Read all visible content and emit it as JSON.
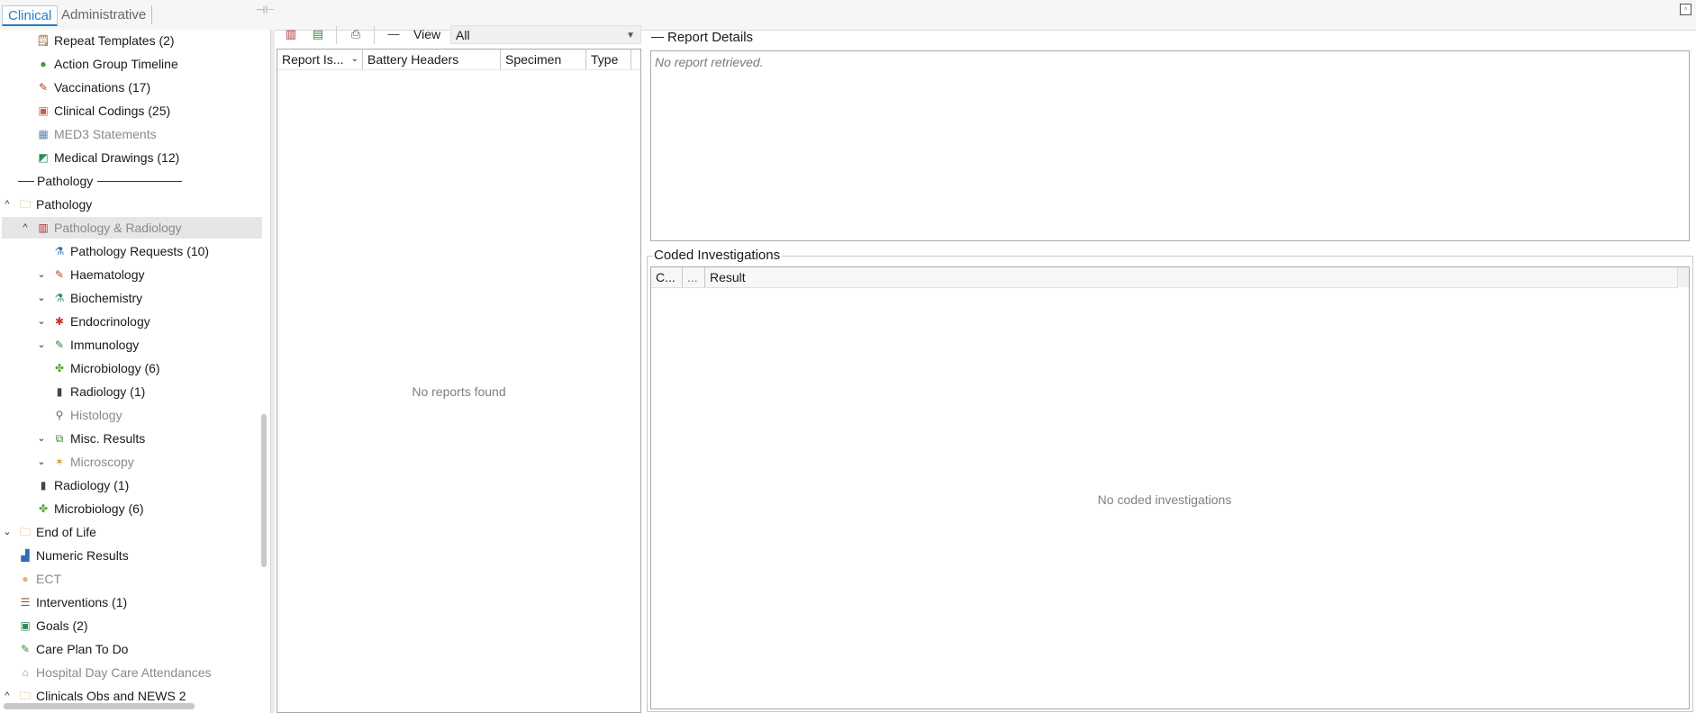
{
  "tabs": {
    "clinical": "Clinical",
    "administrative": "Administrative"
  },
  "tree": [
    {
      "label": "Repeat Templates (2)",
      "icon": "repeat-template-icon",
      "glyph": "🗒",
      "color": "#8a5a2b"
    },
    {
      "label": "Action Group Timeline",
      "icon": "action-group-icon",
      "glyph": "●",
      "color": "#3a9a3a"
    },
    {
      "label": "Vaccinations (17)",
      "icon": "syringe-icon",
      "glyph": "✎",
      "color": "#c0392b"
    },
    {
      "label": "Clinical Codings (25)",
      "icon": "coding-icon",
      "glyph": "▣",
      "color": "#d9534f"
    },
    {
      "label": "MED3 Statements",
      "icon": "med3-icon",
      "glyph": "▦",
      "color": "#5b7fb5"
    },
    {
      "label": "Medical Drawings (12)",
      "icon": "drawing-icon",
      "glyph": "◩",
      "color": "#2e8b57"
    },
    {
      "label": "Pathology",
      "icon": "separator-line-icon",
      "glyph": "",
      "color": "#333333"
    },
    {
      "label": "Pathology",
      "icon": "folder-icon",
      "glyph": "🗀",
      "color": "#c8a02a"
    },
    {
      "label": "Pathology & Radiology",
      "icon": "test-tubes-icon",
      "glyph": "▥",
      "color": "#b03030"
    },
    {
      "label": "Pathology Requests (10)",
      "icon": "flask-request-icon",
      "glyph": "⚗",
      "color": "#2f6db5"
    },
    {
      "label": "Haematology",
      "icon": "pipette-icon",
      "glyph": "✎",
      "color": "#c0392b"
    },
    {
      "label": "Biochemistry",
      "icon": "beaker-icon",
      "glyph": "⚗",
      "color": "#2e8b57"
    },
    {
      "label": "Endocrinology",
      "icon": "endocrine-icon",
      "glyph": "✱",
      "color": "#c0392b"
    },
    {
      "label": "Immunology",
      "icon": "immunology-icon",
      "glyph": "✎",
      "color": "#3a7a3a"
    },
    {
      "label": "Microbiology (6)",
      "icon": "microbe-icon",
      "glyph": "✤",
      "color": "#5aa832"
    },
    {
      "label": "Radiology (1)",
      "icon": "xray-icon",
      "glyph": "▮",
      "color": "#444444"
    },
    {
      "label": "Histology",
      "icon": "microscope-icon",
      "glyph": "⚲",
      "color": "#666666"
    },
    {
      "label": "Misc. Results",
      "icon": "misc-results-icon",
      "glyph": "⧉",
      "color": "#3a8a3a"
    },
    {
      "label": "Microscopy",
      "icon": "microscopy-icon",
      "glyph": "✶",
      "color": "#c8a02a"
    },
    {
      "label": "Radiology (1)",
      "icon": "xray-icon",
      "glyph": "▮",
      "color": "#444444"
    },
    {
      "label": "Microbiology (6)",
      "icon": "microbe-icon",
      "glyph": "✤",
      "color": "#5aa832"
    },
    {
      "label": "End of Life",
      "icon": "folder-icon",
      "glyph": "🗀",
      "color": "#c8a02a"
    },
    {
      "label": "Numeric Results",
      "icon": "bar-chart-icon",
      "glyph": "▟",
      "color": "#2f6db5"
    },
    {
      "label": "ECT",
      "icon": "brain-icon",
      "glyph": "●",
      "color": "#e8b070"
    },
    {
      "label": "Interventions (1)",
      "icon": "interventions-icon",
      "glyph": "☰",
      "color": "#8a5a2b"
    },
    {
      "label": "Goals (2)",
      "icon": "goals-icon",
      "glyph": "▣",
      "color": "#2e8b57"
    },
    {
      "label": "Care Plan To Do",
      "icon": "care-plan-icon",
      "glyph": "✎",
      "color": "#3a8a3a"
    },
    {
      "label": "Hospital Day Care Attendances",
      "icon": "hospital-icon",
      "glyph": "⌂",
      "color": "#d98a2a"
    },
    {
      "label": "Clinicals Obs and NEWS 2",
      "icon": "folder-icon",
      "glyph": "🗀",
      "color": "#c8a02a"
    }
  ],
  "toolbar": {
    "view_label": "View",
    "view_value": "All"
  },
  "reports": {
    "columns": [
      "Report Is...",
      "Battery Headers",
      "Specimen",
      "Type"
    ],
    "empty": "No reports found"
  },
  "report_details": {
    "title": "Report Details",
    "empty": "No report retrieved."
  },
  "coded_investigations": {
    "title": "Coded Investigations",
    "columns": [
      "C...",
      "...",
      "Result"
    ],
    "empty": "No coded investigations"
  }
}
